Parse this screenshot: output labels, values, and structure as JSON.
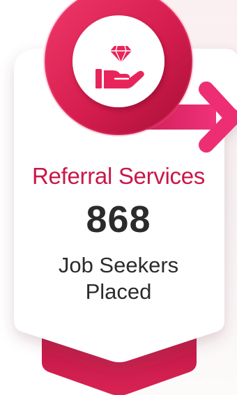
{
  "stat_card": {
    "title": "Referral Services",
    "count": "868",
    "description_line1": "Job Seekers",
    "description_line2": "Placed"
  },
  "icons": {
    "main": "hand-holding-gem-icon",
    "arrow": "arrow-right-icon"
  },
  "colors": {
    "accent": "#e8255b",
    "accent_dark": "#b3133f",
    "text_accent": "#c8174b",
    "text_main": "#2b2b2b",
    "card_bg": "#ffffff"
  }
}
